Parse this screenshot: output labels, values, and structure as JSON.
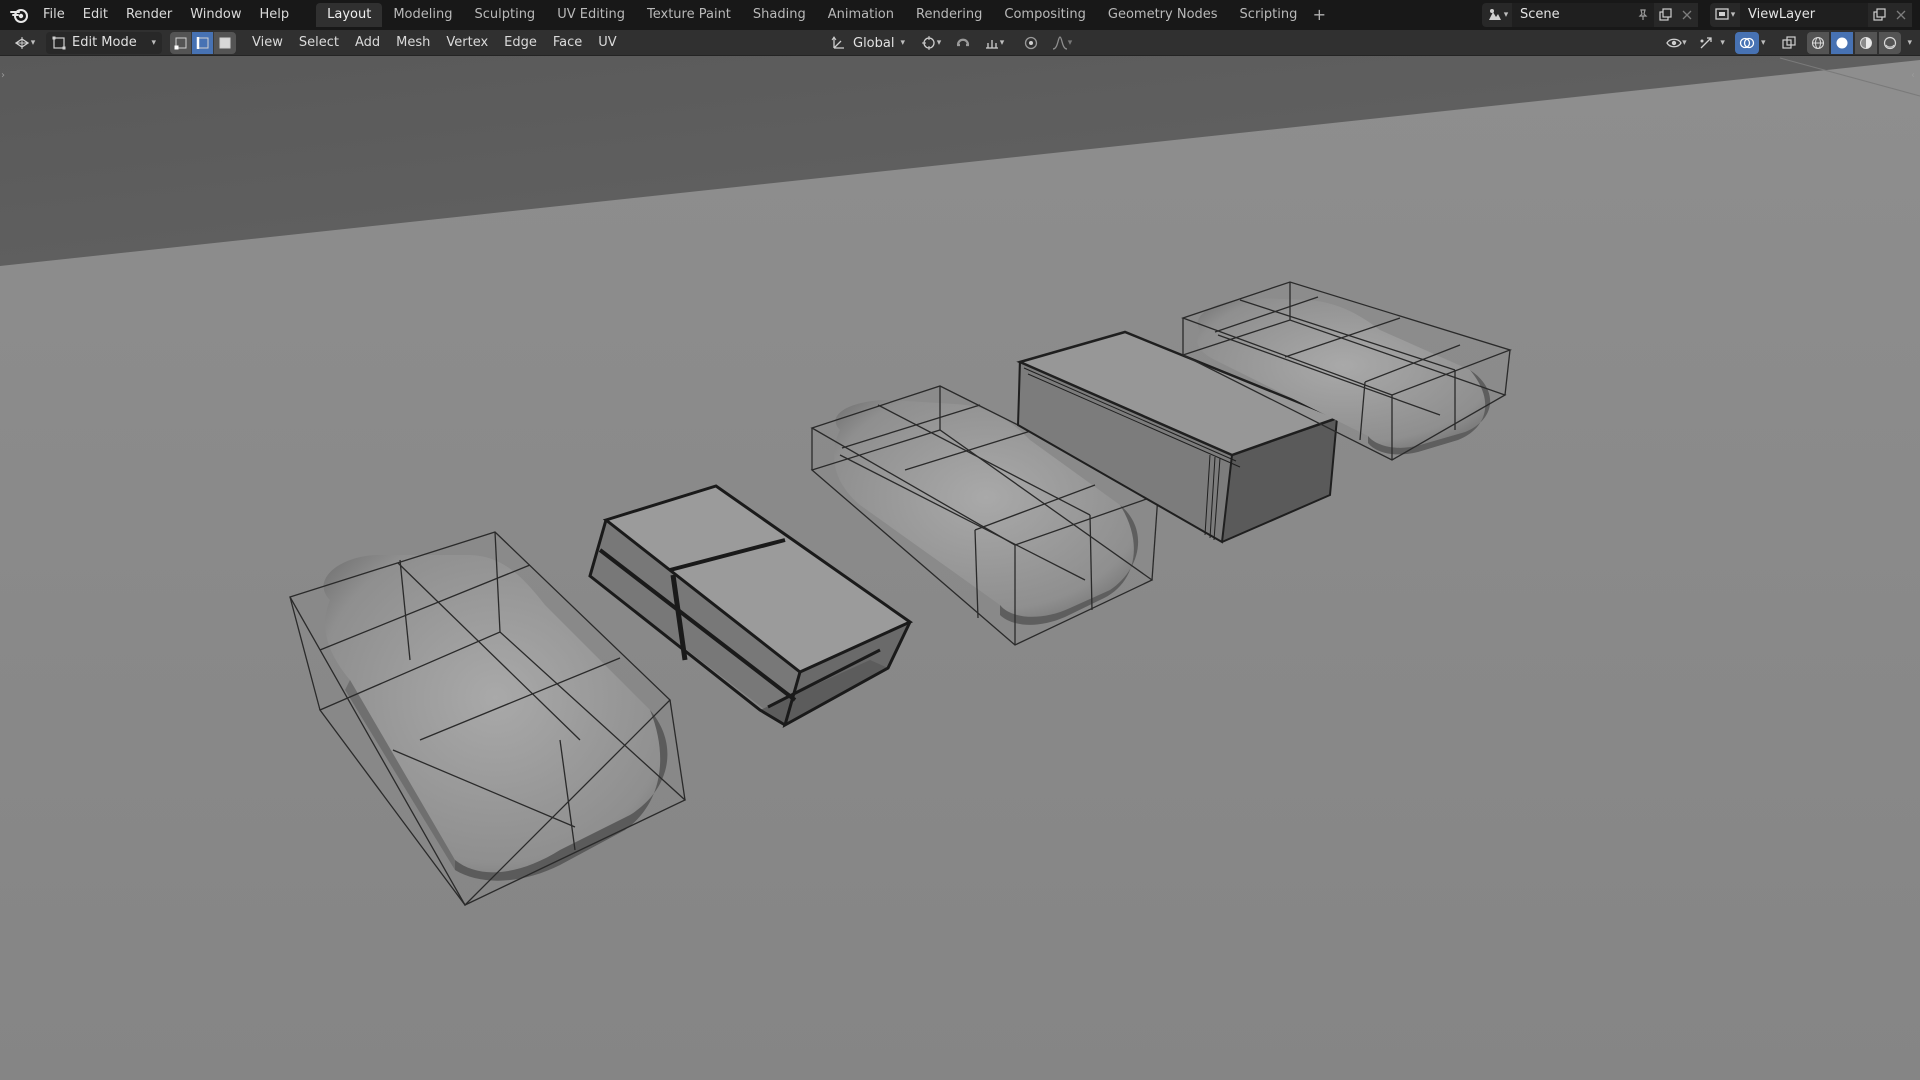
{
  "app": {
    "logo_icon": "blender-logo-icon"
  },
  "menu": [
    "File",
    "Edit",
    "Render",
    "Window",
    "Help"
  ],
  "workspaces": {
    "tabs": [
      "Layout",
      "Modeling",
      "Sculpting",
      "UV Editing",
      "Texture Paint",
      "Shading",
      "Animation",
      "Rendering",
      "Compositing",
      "Geometry Nodes",
      "Scripting"
    ],
    "active": "Layout",
    "add_label": "+"
  },
  "scene": {
    "name": "Scene"
  },
  "view_layer": {
    "name": "ViewLayer"
  },
  "header": {
    "mode": "Edit Mode",
    "select_modes": [
      "vertex-select-icon",
      "edge-select-icon",
      "face-select-icon"
    ],
    "active_select_mode": "edge-select-icon",
    "menus": [
      "View",
      "Select",
      "Add",
      "Mesh",
      "Vertex",
      "Edge",
      "Face",
      "UV"
    ],
    "orientation": "Global",
    "shading_modes": [
      "wireframe-shading-icon",
      "solid-shading-icon",
      "material-shading-icon",
      "rendered-shading-icon"
    ],
    "active_shading": "solid-shading-icon"
  },
  "colors": {
    "accent": "#4772b3",
    "topbar": "#181818",
    "header": "#303030",
    "viewport_floor": "#8a8a8a",
    "viewport_wall": "#5e5e5e"
  },
  "viewport": {
    "objects": [
      "rounded-box-mesh-1",
      "beveled-box-mesh-2",
      "rounded-box-mesh-3",
      "beveled-box-mesh-4",
      "rounded-box-mesh-5"
    ]
  }
}
